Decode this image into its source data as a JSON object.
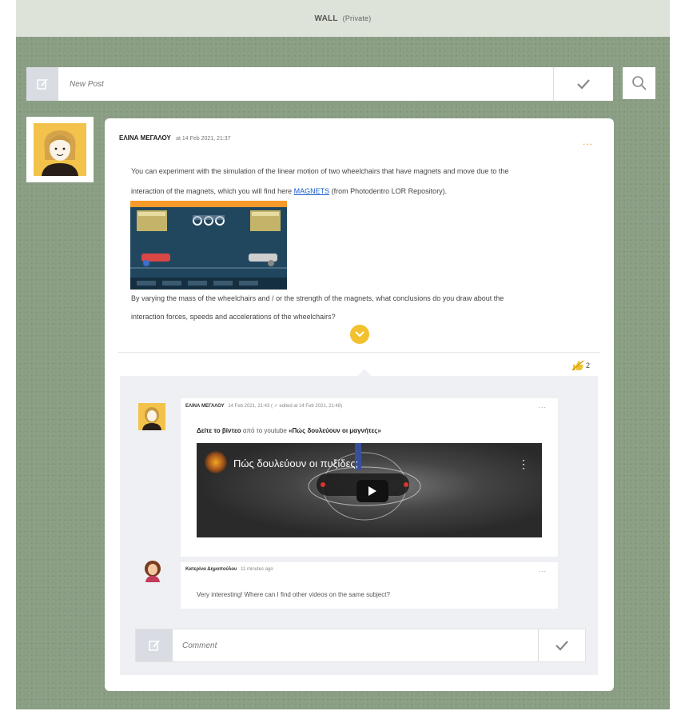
{
  "header": {
    "title": "WALL",
    "subtitle": "(Private)"
  },
  "new_post": {
    "placeholder": "New Post"
  },
  "post": {
    "author": "ΕΛΙΝΑ ΜΕΓΑΛΟΥ",
    "time": "at 14 Feb 2021, 21:37",
    "more": "...",
    "text_line1": "You can experiment with the simulation of the linear motion of two wheelchairs that have magnets and move due to the",
    "text_line2_pre": "interaction of the magnets, which you will find here ",
    "link": "MAGNETS",
    "text_line2_post": " (from Photodentro LOR Repository).",
    "text_line3": "By varying the mass of the wheelchairs and / or the strength of the magnets, what conclusions do you draw about the",
    "text_line4": "interaction forces, speeds and accelerations of the wheelchairs?",
    "like_count": "2"
  },
  "comments": [
    {
      "author": "ΕΛΙΝΑ ΜΕΓΑΛΟΥ",
      "time": "14 Feb 2021, 21:43 ( ✓ edited at 14 Feb 2021, 21:48)",
      "more": "...",
      "text_bold1": "Δείτε το βίντεο",
      "text_mid": " από το youtube ",
      "text_bold2": "«Πώς δουλεύουν οι μαγνήτες»",
      "video_title": "Πώς δουλεύουν οι πυξίδες;",
      "video_menu": "⋮"
    },
    {
      "author": "Κατερίνα Δημοπούλου",
      "time": "11 minutes ago",
      "more": "...",
      "text": "Very interesting! Where can I find other videos on the same subject?"
    }
  ],
  "comment_input": {
    "placeholder": "Comment"
  },
  "colors": {
    "wall_bg": "#8a9e84",
    "accent": "#f2c12e",
    "link": "#1a5dc9"
  }
}
